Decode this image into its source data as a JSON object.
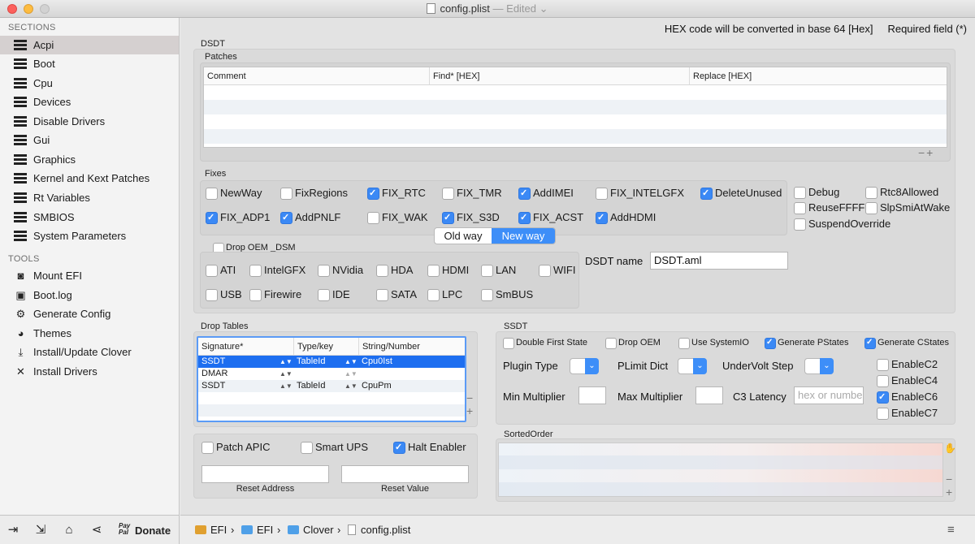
{
  "window": {
    "title": "config.plist",
    "edited": "— Edited ⌄"
  },
  "sidebar": {
    "sections_header": "SECTIONS",
    "sections": [
      {
        "label": "Acpi",
        "icon": "list-icon",
        "selected": true
      },
      {
        "label": "Boot",
        "icon": "list-icon"
      },
      {
        "label": "Cpu",
        "icon": "list-icon"
      },
      {
        "label": "Devices",
        "icon": "list-icon"
      },
      {
        "label": "Disable Drivers",
        "icon": "list-icon"
      },
      {
        "label": "Gui",
        "icon": "list-icon"
      },
      {
        "label": "Graphics",
        "icon": "list-icon"
      },
      {
        "label": "Kernel and Kext Patches",
        "icon": "list-icon"
      },
      {
        "label": "Rt Variables",
        "icon": "list-icon"
      },
      {
        "label": "SMBIOS",
        "icon": "list-icon"
      },
      {
        "label": "System Parameters",
        "icon": "list-icon"
      }
    ],
    "tools_header": "TOOLS",
    "tools": [
      {
        "label": "Mount EFI",
        "icon": "mount-efi-icon"
      },
      {
        "label": "Boot.log",
        "icon": "bootlog-icon"
      },
      {
        "label": "Generate Config",
        "icon": "gears-icon"
      },
      {
        "label": "Themes",
        "icon": "palette-icon"
      },
      {
        "label": "Install/Update Clover",
        "icon": "install-icon"
      },
      {
        "label": "Install Drivers",
        "icon": "tools-icon"
      }
    ],
    "donate_label": "Donate",
    "paypal_text": "Pay Pal"
  },
  "header": {
    "hex_hint": "HEX code will be converted in base 64 [Hex]",
    "required_hint": "Required field (*)"
  },
  "dsdt": {
    "title": "DSDT",
    "patches_label": "Patches",
    "patch_columns": [
      "Comment",
      "Find* [HEX]",
      "Replace [HEX]"
    ],
    "fixes_label": "Fixes",
    "fixes": [
      {
        "label": "NewWay",
        "checked": false
      },
      {
        "label": "FixRegions",
        "checked": false
      },
      {
        "label": "FIX_RTC",
        "checked": true
      },
      {
        "label": "FIX_TMR",
        "checked": false
      },
      {
        "label": "AddIMEI",
        "checked": true
      },
      {
        "label": "FIX_INTELGFX",
        "checked": false
      },
      {
        "label": "DeleteUnused",
        "checked": true
      },
      {
        "label": "FIX_ADP1",
        "checked": true
      },
      {
        "label": "AddPNLF",
        "checked": true
      },
      {
        "label": "FIX_WAK",
        "checked": false
      },
      {
        "label": "FIX_S3D",
        "checked": true
      },
      {
        "label": "FIX_ACST",
        "checked": true
      },
      {
        "label": "AddHDMI",
        "checked": true
      }
    ],
    "extra_fixes": [
      {
        "label": "Debug",
        "checked": false
      },
      {
        "label": "Rtc8Allowed",
        "checked": false
      },
      {
        "label": "ReuseFFFF",
        "checked": false
      },
      {
        "label": "SlpSmiAtWake",
        "checked": false
      },
      {
        "label": "SuspendOverride",
        "checked": false
      }
    ],
    "segment": {
      "old": "Old way",
      "new": "New way",
      "selected": "New way"
    },
    "drop_oem_dsm": {
      "label": "Drop OEM _DSM",
      "checked": false
    },
    "dsm_items": [
      {
        "label": "ATI",
        "checked": false
      },
      {
        "label": "IntelGFX",
        "checked": false
      },
      {
        "label": "NVidia",
        "checked": false
      },
      {
        "label": "HDA",
        "checked": false
      },
      {
        "label": "HDMI",
        "checked": false
      },
      {
        "label": "LAN",
        "checked": false
      },
      {
        "label": "WIFI",
        "checked": false
      },
      {
        "label": "USB",
        "checked": false
      },
      {
        "label": "Firewire",
        "checked": false
      },
      {
        "label": "IDE",
        "checked": false
      },
      {
        "label": "SATA",
        "checked": false
      },
      {
        "label": "LPC",
        "checked": false
      },
      {
        "label": "SmBUS",
        "checked": false
      }
    ],
    "dsdt_name_label": "DSDT name",
    "dsdt_name_value": "DSDT.aml"
  },
  "drop_tables": {
    "title": "Drop Tables",
    "columns": [
      "Signature*",
      "Type/key",
      "String/Number"
    ],
    "rows": [
      {
        "sig": "SSDT",
        "type": "TableId",
        "val": "Cpu0Ist",
        "selected": true
      },
      {
        "sig": "DMAR",
        "type": "",
        "val": ""
      },
      {
        "sig": "SSDT",
        "type": "TableId",
        "val": "CpuPm"
      }
    ]
  },
  "misc": {
    "patch_apic": {
      "label": "Patch APIC",
      "checked": false
    },
    "smart_ups": {
      "label": "Smart UPS",
      "checked": false
    },
    "halt_enabler": {
      "label": "Halt Enabler",
      "checked": true
    },
    "reset_address_label": "Reset Address",
    "reset_value_label": "Reset Value"
  },
  "ssdt": {
    "title": "SSDT",
    "options": [
      {
        "label": "Double First State",
        "checked": false
      },
      {
        "label": "Drop OEM",
        "checked": false
      },
      {
        "label": "Use SystemIO",
        "checked": false
      },
      {
        "label": "Generate PStates",
        "checked": true
      },
      {
        "label": "Generate CStates",
        "checked": true
      }
    ],
    "plugin_type_label": "Plugin Type",
    "plimit_dict_label": "PLimit Dict",
    "undervolt_step_label": "UnderVolt Step",
    "min_multiplier_label": "Min Multiplier",
    "max_multiplier_label": "Max Multiplier",
    "c3_latency_label": "C3 Latency",
    "c3_latency_placeholder": "hex or number",
    "enable_c": [
      {
        "label": "EnableC2",
        "checked": false
      },
      {
        "label": "EnableC4",
        "checked": false
      },
      {
        "label": "EnableC6",
        "checked": true
      },
      {
        "label": "EnableC7",
        "checked": false
      }
    ],
    "sorted_order_label": "SortedOrder"
  },
  "pathbar": {
    "crumbs": [
      "EFI",
      "EFI",
      "Clover",
      "config.plist"
    ],
    "separator": "›"
  },
  "colors": {
    "accent": "#3d8ef8",
    "selected_row": "#1d6ef0",
    "sidebar_selected": "#d5d0d0"
  }
}
